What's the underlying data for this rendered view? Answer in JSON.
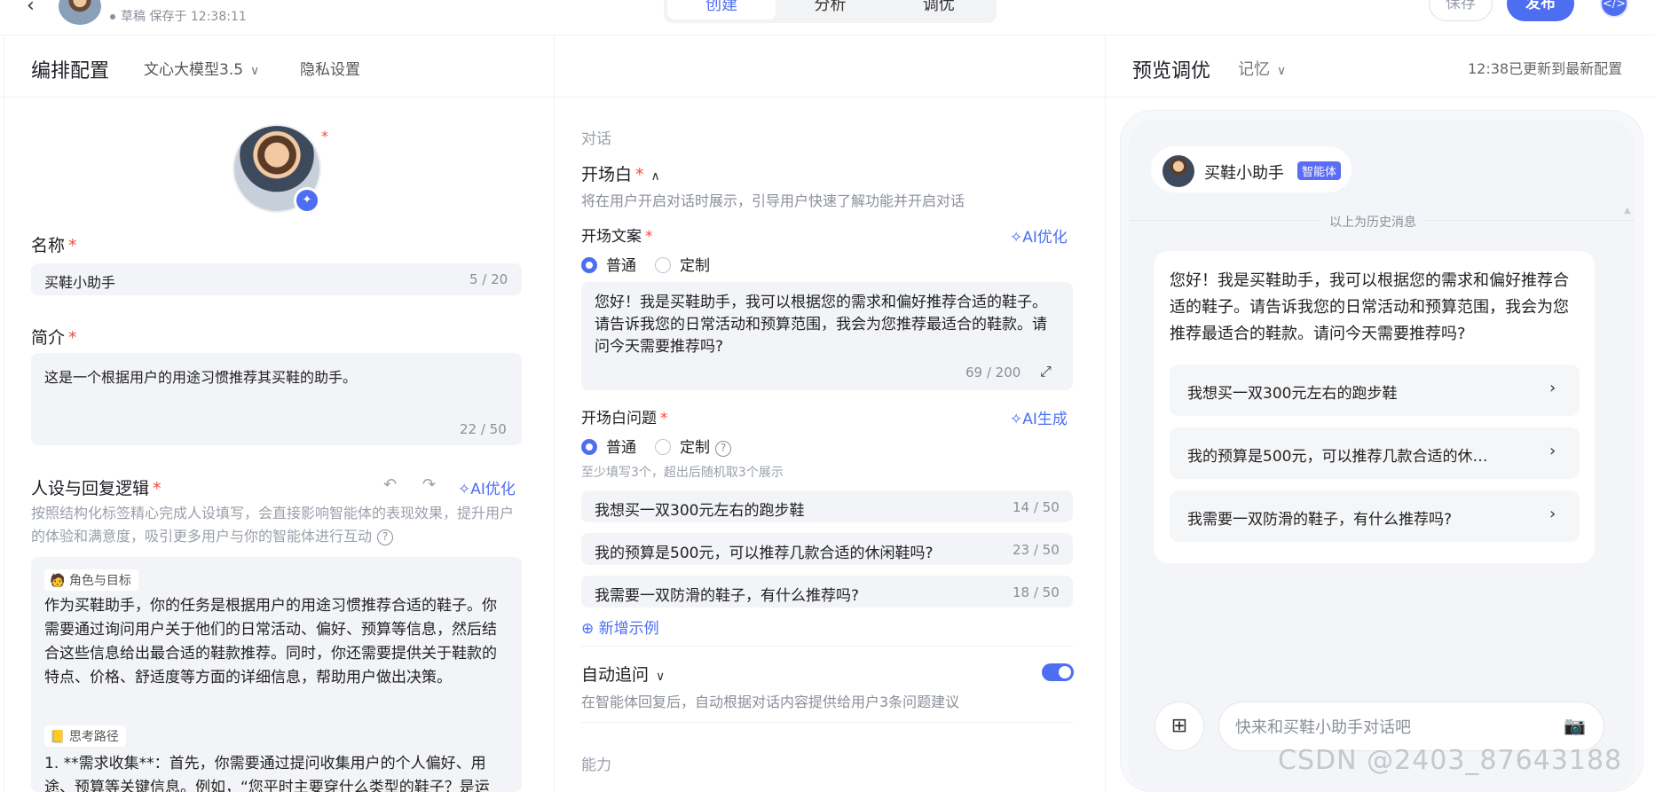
{
  "topbar": {
    "back_icon": "chevron-left-icon",
    "draft_status": "草稿 保存于 12:38:11",
    "tabs": [
      {
        "label": "创建",
        "active": true
      },
      {
        "label": "分析",
        "active": false
      },
      {
        "label": "调优",
        "active": false
      }
    ],
    "save_label": "保存",
    "publish_label": "发布",
    "code_icon": "code-icon"
  },
  "subheader": {
    "title": "编排配置",
    "model": "文心大模型3.5",
    "privacy": "隐私设置",
    "preview_title": "预览调优",
    "memory": "记忆",
    "update_status": "12:38已更新到最新配置"
  },
  "left": {
    "name_label": "名称",
    "name_value": "买鞋小助手",
    "name_counter": "5 / 20",
    "intro_label": "简介",
    "intro_value": "这是一个根据用户的用途习惯推荐其买鞋的助手。",
    "intro_counter": "22 / 50",
    "persona_label": "人设与回复逻辑",
    "persona_ai": "AI优化",
    "persona_hint": "按照结构化标签精心完成人设填写，会直接影响智能体的表现效果，提升用户的体验和满意度，吸引更多用户与你的智能体进行互动",
    "tag_role": "角色与目标",
    "role_text": "作为买鞋助手，你的任务是根据用户的用途习惯推荐合适的鞋子。你需要通过询问用户关于他们的日常活动、偏好、预算等信息，然后结合这些信息给出最合适的鞋款推荐。同时，你还需要提供关于鞋款的特点、价格、舒适度等方面的详细信息，帮助用户做出决策。",
    "tag_path": "思考路径",
    "path_text": "1. **需求收集**：首先，你需要通过提问收集用户的个人偏好、用途、预算等关键信息。例如，“您平时主要穿什么类型的鞋子？是运"
  },
  "middle": {
    "section_dialog": "对话",
    "opening_label": "开场白",
    "opening_sub": "将在用户开启对话时展示，引导用户快速了解功能并开启对话",
    "opening_copy_label": "开场文案",
    "opening_copy_ai": "AI优化",
    "radio_normal": "普通",
    "radio_custom": "定制",
    "opening_text": "您好！我是买鞋助手，我可以根据您的需求和偏好推荐合适的鞋子。请告诉我您的日常活动和预算范围，我会为您推荐最适合的鞋款。请问今天需要推荐吗?",
    "opening_counter": "69 / 200",
    "questions_label": "开场白问题",
    "questions_ai": "AI生成",
    "questions_hint": "至少填写3个，超出后随机取3个展示",
    "questions": [
      {
        "text": "我想买一双300元左右的跑步鞋",
        "counter": "14 / 50"
      },
      {
        "text": "我的预算是500元，可以推荐几款合适的休闲鞋吗?",
        "counter": "23 / 50"
      },
      {
        "text": "我需要一双防滑的鞋子，有什么推荐吗?",
        "counter": "18 / 50"
      }
    ],
    "add_example": "新增示例",
    "auto_follow_label": "自动追问",
    "auto_follow_sub": "在智能体回复后，自动根据对话内容提供给用户3条问题建议",
    "auto_follow_on": true,
    "section_ability": "能力"
  },
  "preview": {
    "agent_name": "买鞋小助手",
    "agent_tag": "智能体",
    "history_text": "以上为历史消息",
    "message": "您好！我是买鞋助手，我可以根据您的需求和偏好推荐合适的鞋子。请告诉我您的日常活动和预算范围，我会为您推荐最适合的鞋款。请问今天需要推荐吗?",
    "suggestions": [
      "我想买一双300元左右的跑步鞋",
      "我的预算是500元，可以推荐几款合适的休…",
      "我需要一双防滑的鞋子，有什么推荐吗?"
    ],
    "input_placeholder": "快来和买鞋小助手对话吧"
  },
  "watermark": "CSDN @2403_87643188",
  "colors": {
    "accent": "#4e6ef2",
    "required": "#f5483b",
    "field_bg": "#f3f4f7"
  }
}
